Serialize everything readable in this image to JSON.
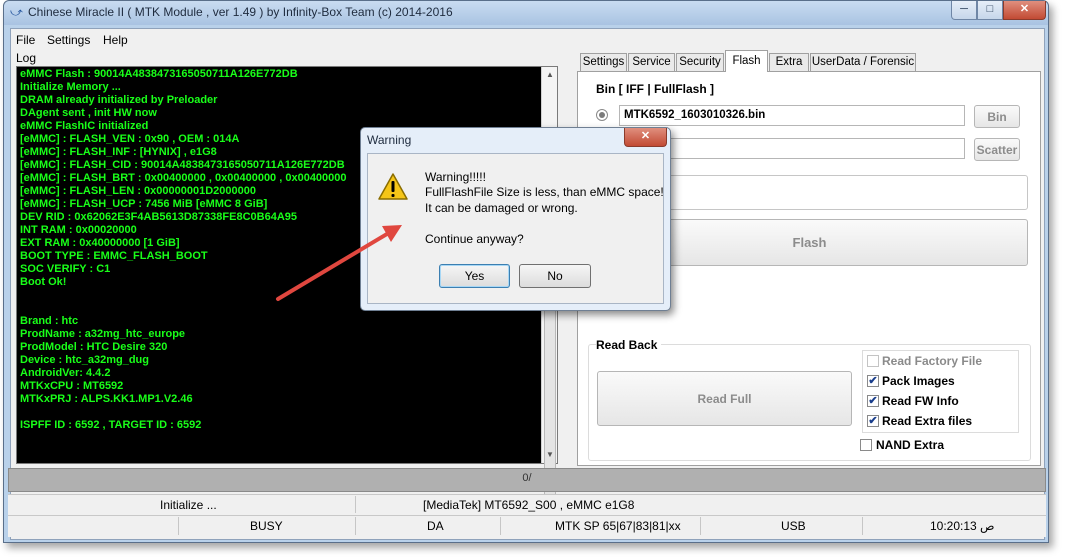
{
  "window": {
    "title": "Chinese Miracle II ( MTK Module , ver 1.49 ) by Infinity-Box Team (c) 2014-2016",
    "min_glyph": "─",
    "max_glyph": "□",
    "close_glyph": "✕"
  },
  "menu": [
    "File",
    "Settings",
    "Help"
  ],
  "log": {
    "label": "Log",
    "lines": [
      "eMMC Flash : 90014A4838473165050711A126E772DB",
      "Initialize Memory ...",
      "DRAM already initialized by Preloader",
      "DAgent sent , init HW now",
      "eMMC FlashIC initialized",
      "[eMMC] : FLASH_VEN : 0x90 , OEM : 014A",
      "[eMMC] : FLASH_INF : [HYNIX] , e1G8",
      "[eMMC] : FLASH_CID : 90014A4838473165050711A126E772DB",
      "[eMMC] : FLASH_BRT : 0x00400000 , 0x00400000 , 0x00400000",
      "[eMMC] : FLASH_LEN : 0x00000001D2000000",
      "[eMMC] : FLASH_UCP : 7456 MiB [eMMC 8 GiB]",
      "DEV RID   : 0x62062E3F4AB5613D87338FE8C0B64A95",
      "INT RAM    : 0x00020000",
      "EXT RAM    : 0x40000000 [1 GiB]",
      "BOOT TYPE : EMMC_FLASH_BOOT",
      "SOC VERIFY : C1",
      "Boot Ok!",
      "",
      "",
      "Brand     : htc",
      "ProdName  : a32mg_htc_europe",
      "ProdModel : HTC Desire 320",
      "Device    : htc_a32mg_dug",
      "AndroidVer: 4.4.2",
      "MTKxCPU   : MT6592",
      "MTKxPRJ   : ALPS.KK1.MP1.V2.46",
      "",
      "ISPFF ID : 6592 , TARGET ID : 6592"
    ]
  },
  "tabs": [
    "Settings",
    "Service",
    "Security",
    "Flash",
    "Extra",
    "UserData / Forensic"
  ],
  "active_tab": "Flash",
  "flash": {
    "group_label": "Bin  [ IFF | FullFlash ]",
    "bin_file": "MTK6592_1603010326.bin",
    "bin_button": "Bin",
    "scatter_button": "Scatter",
    "flash_button": "Flash"
  },
  "readback": {
    "label": "Read Back",
    "read_full_button": "Read Full",
    "options": [
      {
        "label": "Read Factory File",
        "checked": false,
        "disabled": true
      },
      {
        "label": "Pack Images",
        "checked": true,
        "disabled": false
      },
      {
        "label": "Read FW Info",
        "checked": true,
        "disabled": false
      },
      {
        "label": "Read Extra files",
        "checked": true,
        "disabled": false
      }
    ],
    "nand_extra": {
      "label": "NAND Extra",
      "checked": false
    }
  },
  "progress": {
    "text": "0/",
    "value": 0
  },
  "status_top": {
    "left": "Initialize ...",
    "right": "[MediaTek] MT6592_S00 , eMMC e1G8"
  },
  "status_bottom": {
    "c1": "BUSY",
    "c2": "DA",
    "c3": "MTK SP 65|67|83|81|xx",
    "c4": "USB",
    "c5": "10:20:13 ص"
  },
  "dialog": {
    "title": "Warning",
    "close_glyph": "✕",
    "line1": "Warning!!!!!",
    "line2": "FullFlashFile Size is less, than eMMC space!",
    "line3": "It can be damaged or wrong.",
    "question": "Continue anyway?",
    "yes": "Yes",
    "no": "No"
  },
  "colors": {
    "log_text": "#19ff19",
    "log_bg": "#000000",
    "annotation_arrow": "#e0473f"
  }
}
